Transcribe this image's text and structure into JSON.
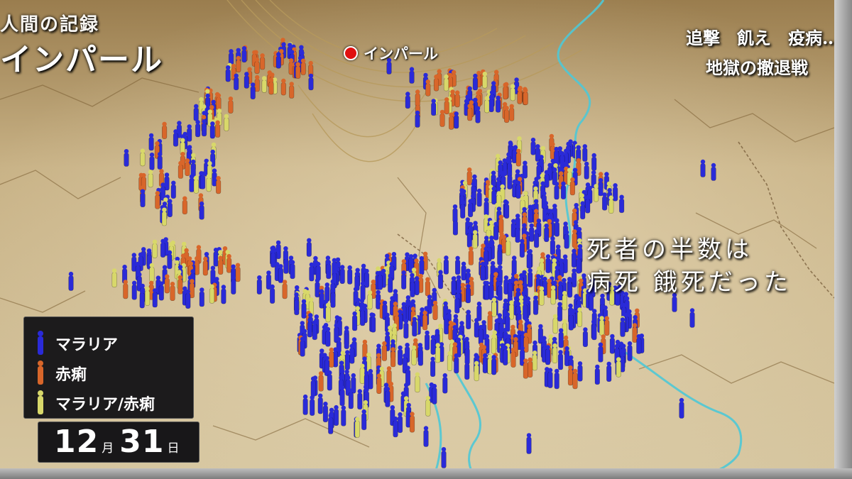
{
  "program": {
    "title_top": "人間の記録",
    "title_main": "インパール"
  },
  "subtitle": {
    "line1": "追撃　飢え　疫病…",
    "line2": "地獄の撤退戦"
  },
  "caption": {
    "line1": "死者の半数は",
    "line2": "病死 餓死だった"
  },
  "city": {
    "name": "インパール",
    "marker_icon": "red-dot-marker"
  },
  "legend": {
    "items": [
      {
        "label": "マラリア",
        "color": "#2a2ad8",
        "icon": "soldier-figure-icon"
      },
      {
        "label": "赤痢",
        "color": "#d8662a",
        "icon": "soldier-figure-icon"
      },
      {
        "label": "マラリア/赤痢",
        "color": "#d8d86a",
        "icon": "soldier-figure-icon"
      }
    ]
  },
  "date": {
    "month": "12",
    "month_unit": "月",
    "day": "31",
    "day_unit": "日"
  },
  "colors": {
    "malaria": "#2a2ad8",
    "dysentery": "#d8662a",
    "both": "#d8d86a",
    "river": "#4ec8d6",
    "terrain": "#c9b58a"
  }
}
